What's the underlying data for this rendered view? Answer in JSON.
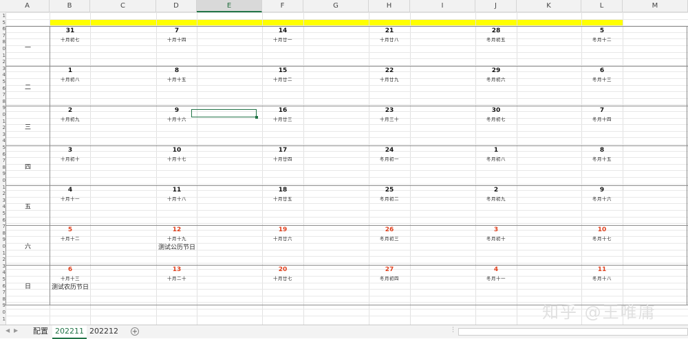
{
  "columns": [
    "A",
    "B",
    "C",
    "D",
    "E",
    "F",
    "G",
    "H",
    "I",
    "J",
    "K",
    "L",
    "M"
  ],
  "row_numbers": [
    "1",
    "5",
    "6",
    "7",
    "8",
    "0",
    "1",
    "2",
    "3",
    "4",
    "5",
    "6",
    "7",
    "8",
    "9",
    "0",
    "1",
    "2",
    "3",
    "4",
    "5",
    "6",
    "7",
    "8",
    "9",
    "0",
    "1",
    "2",
    "3",
    "4",
    "5",
    "6",
    "7",
    "8",
    "9",
    "0",
    "1",
    "2",
    "3",
    "4",
    "5",
    "6",
    "7",
    "8",
    "9",
    "0",
    "1",
    "2",
    "3",
    "4",
    "5",
    "6",
    "7",
    "8",
    "9",
    "0",
    "1",
    "2"
  ],
  "weekdays": [
    "一",
    "二",
    "三",
    "四",
    "五",
    "六",
    "日"
  ],
  "weeks": [
    [
      {
        "d": "31",
        "l": "十月初七"
      },
      {
        "d": "7",
        "l": "十月十四"
      },
      {
        "d": "14",
        "l": "十月廿一"
      },
      {
        "d": "21",
        "l": "十月廿八"
      },
      {
        "d": "28",
        "l": "冬月初五"
      },
      {
        "d": "5",
        "l": "冬月十二"
      }
    ],
    [
      {
        "d": "1",
        "l": "十月初八"
      },
      {
        "d": "8",
        "l": "十月十五"
      },
      {
        "d": "15",
        "l": "十月廿二"
      },
      {
        "d": "22",
        "l": "十月廿九"
      },
      {
        "d": "29",
        "l": "冬月初六"
      },
      {
        "d": "6",
        "l": "冬月十三"
      }
    ],
    [
      {
        "d": "2",
        "l": "十月初九"
      },
      {
        "d": "9",
        "l": "十月十六"
      },
      {
        "d": "16",
        "l": "十月廿三"
      },
      {
        "d": "23",
        "l": "十月三十"
      },
      {
        "d": "30",
        "l": "冬月初七"
      },
      {
        "d": "7",
        "l": "冬月十四"
      }
    ],
    [
      {
        "d": "3",
        "l": "十月初十"
      },
      {
        "d": "10",
        "l": "十月十七"
      },
      {
        "d": "17",
        "l": "十月廿四"
      },
      {
        "d": "24",
        "l": "冬月初一"
      },
      {
        "d": "1",
        "l": "冬月初八"
      },
      {
        "d": "8",
        "l": "冬月十五"
      }
    ],
    [
      {
        "d": "4",
        "l": "十月十一"
      },
      {
        "d": "11",
        "l": "十月十八"
      },
      {
        "d": "18",
        "l": "十月廿五"
      },
      {
        "d": "25",
        "l": "冬月初二"
      },
      {
        "d": "2",
        "l": "冬月初九"
      },
      {
        "d": "9",
        "l": "冬月十六"
      }
    ],
    [
      {
        "d": "5",
        "l": "十月十二"
      },
      {
        "d": "12",
        "l": "十月十九"
      },
      {
        "d": "19",
        "l": "十月廿六"
      },
      {
        "d": "26",
        "l": "冬月初三"
      },
      {
        "d": "3",
        "l": "冬月初十"
      },
      {
        "d": "10",
        "l": "冬月十七"
      }
    ],
    [
      {
        "d": "6",
        "l": "十月十三"
      },
      {
        "d": "13",
        "l": "十月二十"
      },
      {
        "d": "20",
        "l": "十月廿七"
      },
      {
        "d": "27",
        "l": "冬月初四"
      },
      {
        "d": "4",
        "l": "冬月十一"
      },
      {
        "d": "11",
        "l": "冬月十八"
      }
    ]
  ],
  "festivals": {
    "gregorian": "测试公历节日",
    "lunar": "测试农历节日"
  },
  "weekend_color": "#e0401d",
  "highlight_color": "#ffff00",
  "sheet_tabs": [
    "配置",
    "202211",
    "202212"
  ],
  "active_tab": "202211",
  "watermark": "知乎 @王唯庸",
  "icons": {
    "add_sheet": "plus-circle-icon",
    "nav_prev": "caret-left-icon",
    "nav_next": "caret-right-icon"
  }
}
